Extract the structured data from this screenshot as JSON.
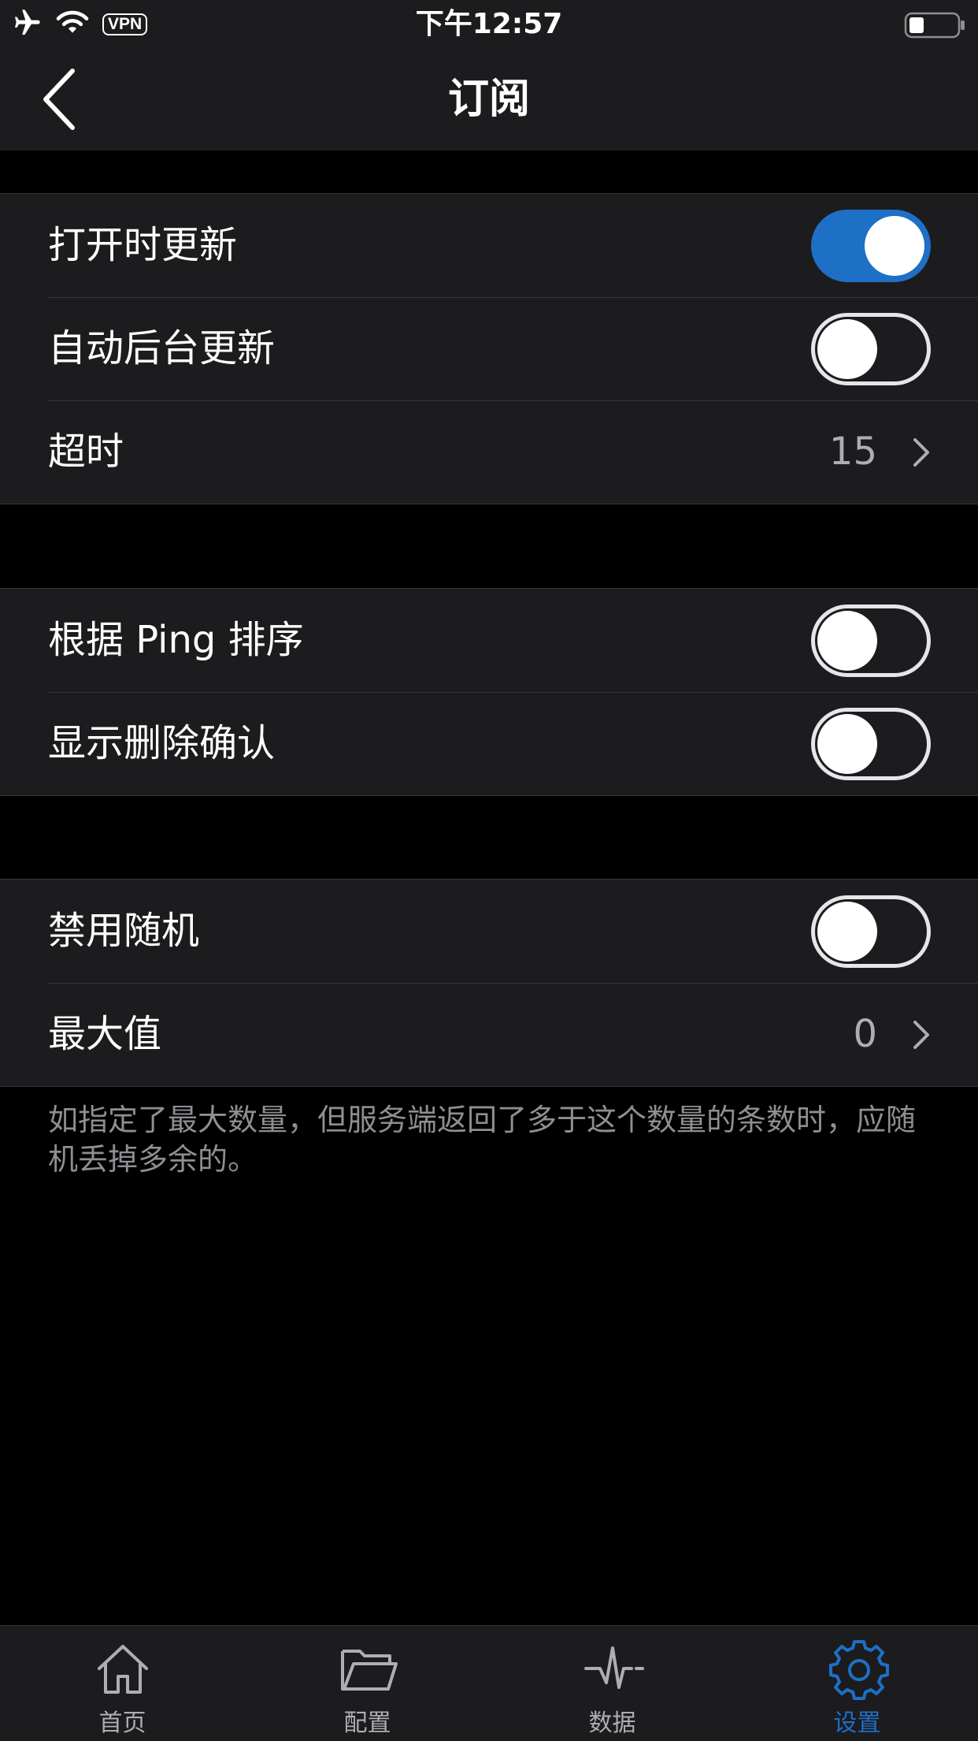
{
  "status_bar": {
    "time": "下午12:57",
    "vpn_label": "VPN",
    "icons": [
      "airplane-icon",
      "wifi-icon",
      "battery-icon"
    ]
  },
  "nav": {
    "title": "订阅",
    "back_icon": "chevron-left-icon"
  },
  "groups": [
    {
      "rows": [
        {
          "label": "打开时更新",
          "type": "toggle",
          "on": true
        },
        {
          "label": "自动后台更新",
          "type": "toggle",
          "on": false
        },
        {
          "label": "超时",
          "type": "value",
          "value": "15"
        }
      ]
    },
    {
      "rows": [
        {
          "label": "根据 Ping 排序",
          "type": "toggle",
          "on": false
        },
        {
          "label": "显示删除确认",
          "type": "toggle",
          "on": false
        }
      ]
    },
    {
      "rows": [
        {
          "label": "禁用随机",
          "type": "toggle",
          "on": false
        },
        {
          "label": "最大值",
          "type": "value",
          "value": "0"
        }
      ],
      "footnote": "如指定了最大数量，但服务端返回了多于这个数量的条数时，应随机丢掉多余的。"
    }
  ],
  "tabbar": {
    "tabs": [
      {
        "label": "首页",
        "icon": "home-icon",
        "active": false
      },
      {
        "label": "配置",
        "icon": "folder-icon",
        "active": false
      },
      {
        "label": "数据",
        "icon": "pulse-icon",
        "active": false
      },
      {
        "label": "设置",
        "icon": "gear-icon",
        "active": true
      }
    ]
  },
  "colors": {
    "accent": "#1e6fc6",
    "background": "#000000",
    "cell_background": "#1c1c1e",
    "secondary_text": "#8e8e93"
  }
}
